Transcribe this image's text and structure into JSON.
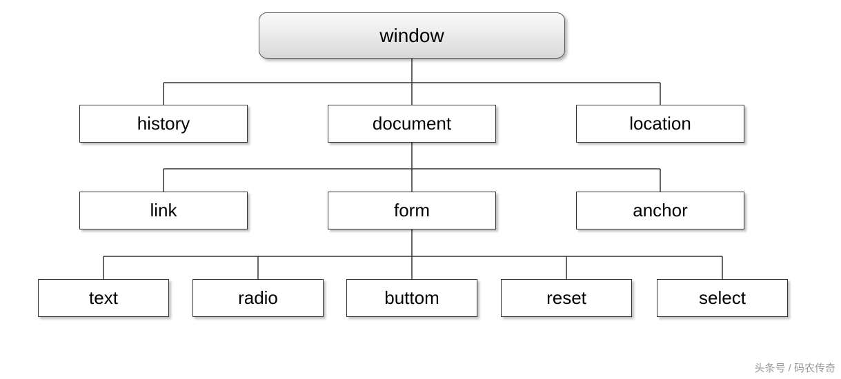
{
  "root": {
    "label": "window"
  },
  "level1": {
    "history": {
      "label": "history"
    },
    "document": {
      "label": "document"
    },
    "location": {
      "label": "location"
    }
  },
  "level2": {
    "link": {
      "label": "link"
    },
    "form": {
      "label": "form"
    },
    "anchor": {
      "label": "anchor"
    }
  },
  "level3": {
    "text": {
      "label": "text"
    },
    "radio": {
      "label": "radio"
    },
    "buttom": {
      "label": "buttom"
    },
    "reset": {
      "label": "reset"
    },
    "select": {
      "label": "select"
    }
  },
  "watermark": "头条号 / 码农传奇",
  "chart_data": {
    "type": "tree",
    "title": "",
    "root": {
      "name": "window",
      "children": [
        {
          "name": "history"
        },
        {
          "name": "document",
          "children": [
            {
              "name": "link"
            },
            {
              "name": "form",
              "children": [
                {
                  "name": "text"
                },
                {
                  "name": "radio"
                },
                {
                  "name": "buttom"
                },
                {
                  "name": "reset"
                },
                {
                  "name": "select"
                }
              ]
            },
            {
              "name": "anchor"
            }
          ]
        },
        {
          "name": "location"
        }
      ]
    }
  }
}
